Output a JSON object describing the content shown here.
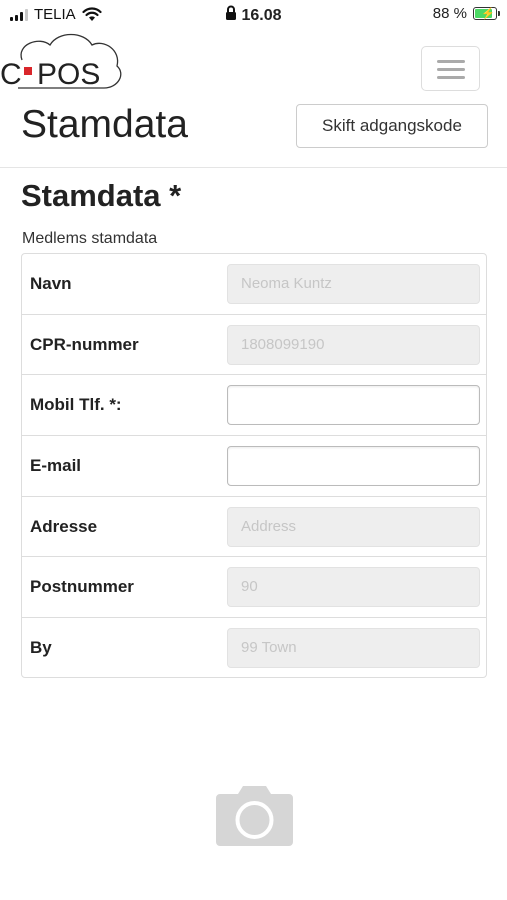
{
  "status_bar": {
    "carrier": "TELIA",
    "time": "16.08",
    "battery_percent": "88 %",
    "battery_level": 0.88,
    "icons": [
      "signal-icon",
      "wifi-icon",
      "lock-icon",
      "battery-charging-icon"
    ]
  },
  "header": {
    "logo_text": "C•POS",
    "title": "Stamdata",
    "change_password_label": "Skift adgangskode"
  },
  "form": {
    "heading": "Stamdata *",
    "panel_caption": "Medlems stamdata",
    "fields": [
      {
        "label": "Navn",
        "value": "Neoma Kuntz",
        "editable": false
      },
      {
        "label": "CPR-nummer",
        "value": "1808099190",
        "editable": false
      },
      {
        "label": "Mobil Tlf. *:",
        "value": "",
        "editable": true
      },
      {
        "label": "E-mail",
        "value": "",
        "editable": true
      },
      {
        "label": "Adresse",
        "value": "Address",
        "editable": false
      },
      {
        "label": "Postnummer",
        "value": "90",
        "editable": false
      },
      {
        "label": "By",
        "value": "99 Town",
        "editable": false
      }
    ]
  },
  "colors": {
    "disabled_field_bg": "#eeeeee",
    "border": "#dddddd",
    "camera_icon": "#d6d6d6",
    "battery_fill": "#4cd964"
  }
}
